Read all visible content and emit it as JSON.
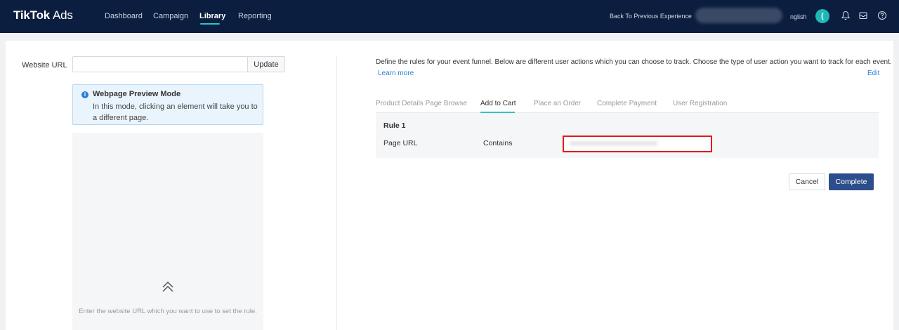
{
  "header": {
    "logo_main": "TikTok",
    "logo_sub": "Ads",
    "nav": [
      {
        "label": "Dashboard"
      },
      {
        "label": "Campaign"
      },
      {
        "label": "Library"
      },
      {
        "label": "Reporting"
      }
    ],
    "active_nav": "Library",
    "back_link": "Back To Previous Experience",
    "language": "nglish",
    "avatar_letter": "(",
    "icons": [
      "bell-icon",
      "mail-icon",
      "help-icon"
    ]
  },
  "left": {
    "url_label": "Website URL",
    "url_value": "",
    "update_label": "Update",
    "info_title": "Webpage Preview Mode",
    "info_text": "In this mode, clicking an element will take you to a different page.",
    "preview_hint": "Enter the website URL which you want to use to set the rule."
  },
  "right": {
    "description": "Define the rules for your event funnel. Below are different user actions which you can choose to track. Choose the type of user action you want to track for each event.",
    "learn_more": "Learn more",
    "edit": "Edit",
    "tabs": [
      {
        "label": "Product Details Page Browse"
      },
      {
        "label": "Add to Cart"
      },
      {
        "label": "Place an Order"
      },
      {
        "label": "Complete Payment"
      },
      {
        "label": "User Registration"
      }
    ],
    "active_tab": "Add to Cart",
    "rule": {
      "title": "Rule 1",
      "field": "Page URL",
      "operator": "Contains",
      "value": "xxxxxxxxxxxxxxxxxxxxxxxxx"
    },
    "cancel_label": "Cancel",
    "complete_label": "Complete"
  },
  "colors": {
    "topbar": "#0b1e3f",
    "accent": "#2ec4c4",
    "link": "#2b7fd9",
    "primary_button": "#2d4e8c",
    "highlight_border": "#e0191f"
  }
}
